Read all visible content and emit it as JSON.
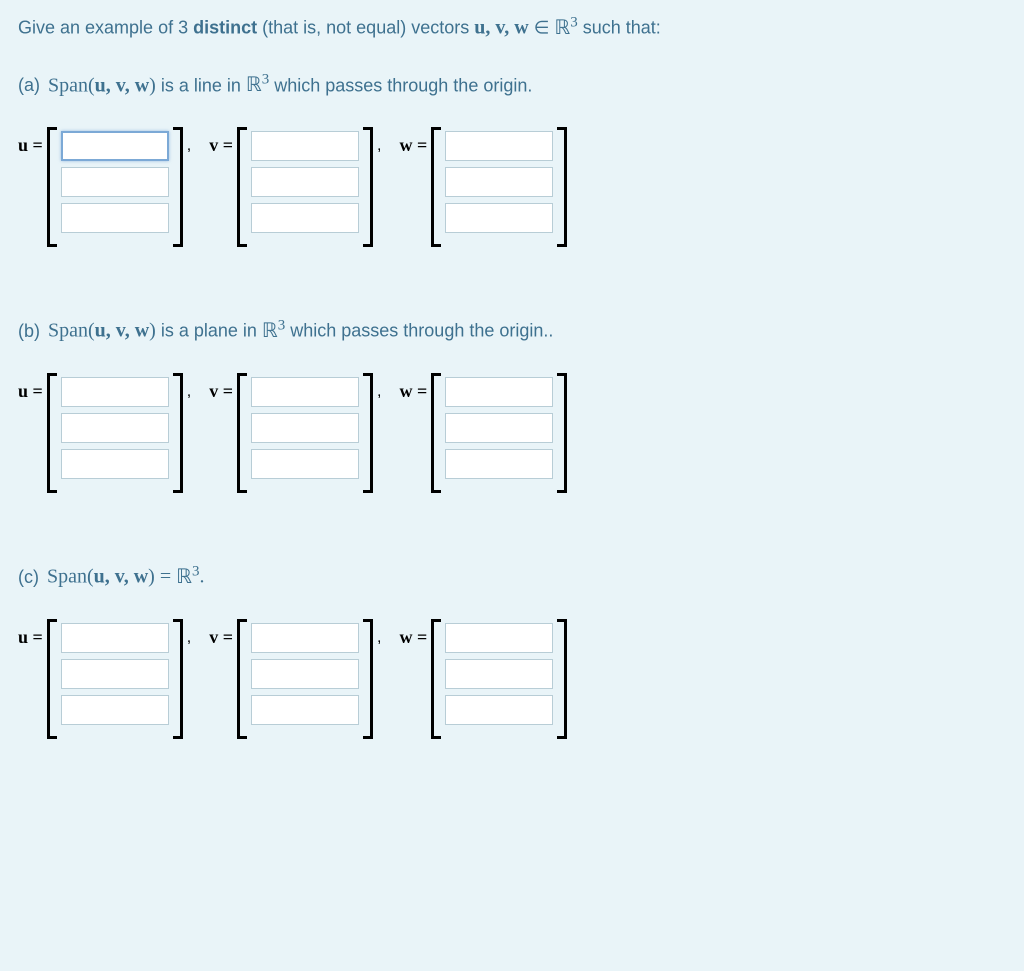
{
  "intro": {
    "t1": "Give an example  of 3 ",
    "distinct": "distinct",
    "t2": " (that is, not equal) vectors ",
    "uvw": "u, v, w",
    "t3": " ∈ ",
    "R": "ℝ",
    "sup": "3",
    "t4": " such that:"
  },
  "parts": {
    "a": {
      "label": "(a) ",
      "span": "Span(",
      "uvw": "u, v, w",
      "close": ")",
      "t1": " is a line in ",
      "R": "ℝ",
      "sup": "3",
      "t2": " which passes through the origin."
    },
    "b": {
      "label": "(b) ",
      "span": "Span(",
      "uvw": "u, v, w",
      "close": ")",
      "t1": " is a plane in ",
      "R": "ℝ",
      "sup": "3",
      "t2": " which passes through the origin.."
    },
    "c": {
      "label": "(c) ",
      "span": "Span(",
      "uvw": "u, v, w",
      "close": ")",
      "eq": " = ",
      "R": "ℝ",
      "sup": "3",
      "dot": "."
    }
  },
  "labels": {
    "u": "u =",
    "v": "v =",
    "w": "w =",
    "comma": ","
  }
}
